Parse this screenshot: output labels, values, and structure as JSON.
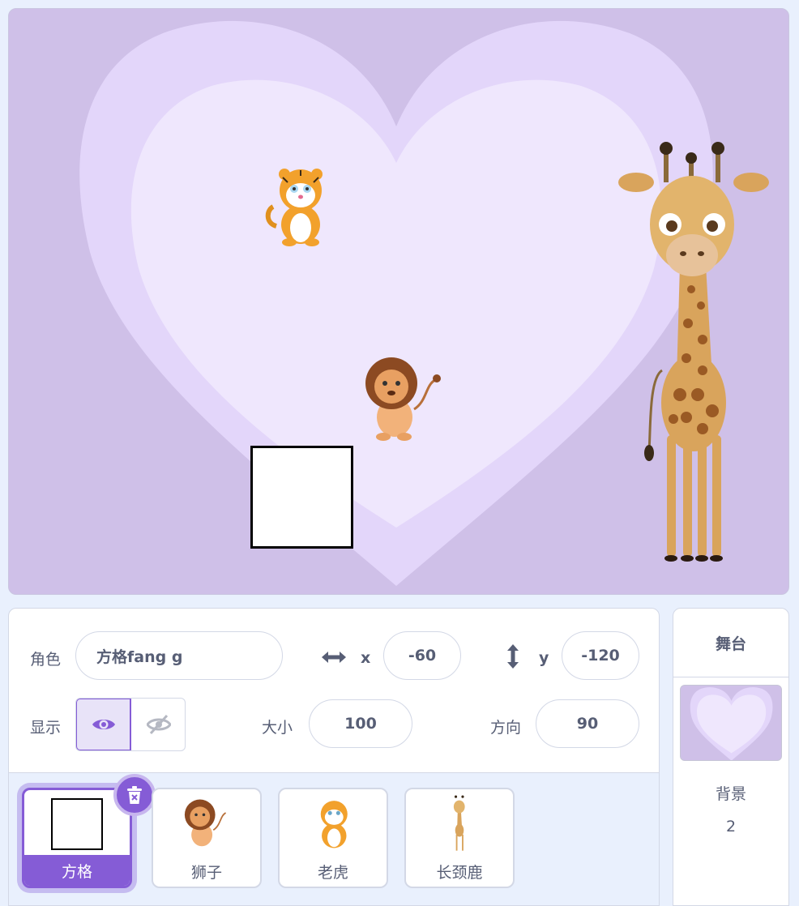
{
  "sprite_info": {
    "sprite_label": "角色",
    "sprite_name": "方格fang g",
    "x_label": "x",
    "x_value": "-60",
    "y_label": "y",
    "y_value": "-120",
    "show_label": "显示",
    "size_label": "大小",
    "size_value": "100",
    "direction_label": "方向",
    "direction_value": "90"
  },
  "sprites": [
    {
      "name": "方格",
      "selected": true
    },
    {
      "name": "狮子",
      "selected": false
    },
    {
      "name": "老虎",
      "selected": false
    },
    {
      "name": "长颈鹿",
      "selected": false
    }
  ],
  "stage_pane": {
    "title": "舞台",
    "backdrop_label": "背景",
    "backdrop_count": "2"
  },
  "colors": {
    "accent": "#855cd6",
    "stage_bg": "#cfc0e8",
    "heart_outer": "#e3d6fa",
    "heart_inner": "#efe7fd"
  }
}
